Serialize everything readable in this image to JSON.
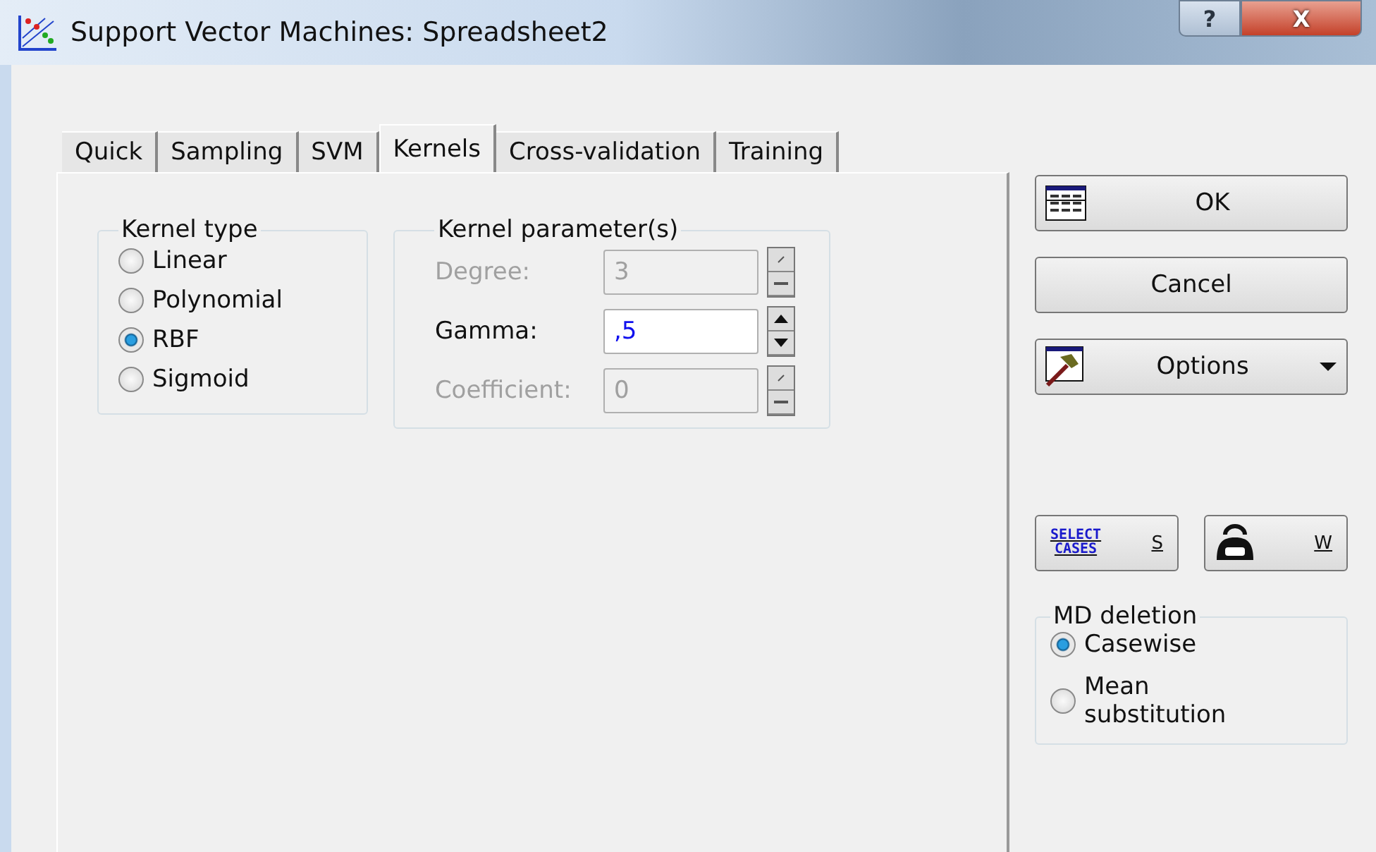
{
  "window": {
    "title": "Support Vector Machines: Spreadsheet2",
    "help": "?",
    "close": "X"
  },
  "tabs": [
    {
      "label": "Quick",
      "selected": false
    },
    {
      "label": "Sampling",
      "selected": false
    },
    {
      "label": "SVM",
      "selected": false
    },
    {
      "label": "Kernels",
      "selected": true
    },
    {
      "label": "Cross-validation",
      "selected": false
    },
    {
      "label": "Training",
      "selected": false
    }
  ],
  "kernel_type": {
    "title": "Kernel type",
    "options": [
      {
        "label": "Linear",
        "selected": false
      },
      {
        "label": "Polynomial",
        "selected": false
      },
      {
        "label": "RBF",
        "selected": true
      },
      {
        "label": "Sigmoid",
        "selected": false
      }
    ]
  },
  "kernel_parameters": {
    "title": "Kernel parameter(s)",
    "fields": [
      {
        "label": "Degree:",
        "value": "3",
        "disabled": true
      },
      {
        "label": "Gamma:",
        "value": ",5",
        "disabled": false
      },
      {
        "label": "Coefficient:",
        "value": "0",
        "disabled": true
      }
    ]
  },
  "buttons": [
    {
      "kind": "ok",
      "label": "OK"
    },
    {
      "kind": "plain",
      "label": "Cancel"
    },
    {
      "kind": "options",
      "label": "Options"
    }
  ],
  "small_buttons": [
    {
      "kind": "select",
      "icon_text": "SELECT CASES",
      "label": "S"
    },
    {
      "kind": "weight",
      "label": "W"
    }
  ],
  "md_deletion": {
    "title": "MD deletion",
    "options": [
      {
        "label": "Casewise",
        "selected": true
      },
      {
        "label": "Mean substitution",
        "selected": false
      }
    ]
  }
}
